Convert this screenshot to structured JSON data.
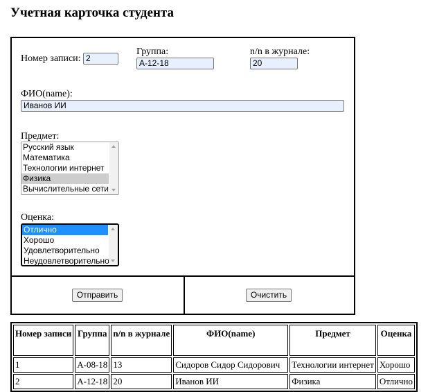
{
  "title": "Учетная карточка студента",
  "form": {
    "record_label": "Номер записи:",
    "record_value": "2",
    "group_label": "Группа:",
    "group_value": "А-12-18",
    "journal_label": "n/n в журнале:",
    "journal_value": "20",
    "name_label": "ФИО(name):",
    "name_value": "Иванов ИИ",
    "subject_label": "Предмет:",
    "subjects": [
      "Русский язык",
      "Математика",
      "Технологии интернет",
      "Физика",
      "Вычислительные сети"
    ],
    "subject_selected": "Физика",
    "grade_label": "Оценка:",
    "grades": [
      "Отлично",
      "Хорошо",
      "Удовлетворительно",
      "Неудовлетворительно"
    ],
    "grade_selected": "Отлично",
    "submit_label": "Отправить",
    "clear_label": "Очистить"
  },
  "table": {
    "headers": [
      "Номер записи",
      "Группа",
      "n/n в журнале",
      "ФИО(name)",
      "Предмет",
      "Оценка"
    ],
    "rows": [
      [
        "1",
        "А-08-18",
        "13",
        "Сидоров Сидор Сидорович",
        "Технологии интернет",
        "Хорошо"
      ],
      [
        "2",
        "А-12-18",
        "20",
        "Иванов ИИ",
        "Физика",
        "Отлично"
      ]
    ]
  }
}
